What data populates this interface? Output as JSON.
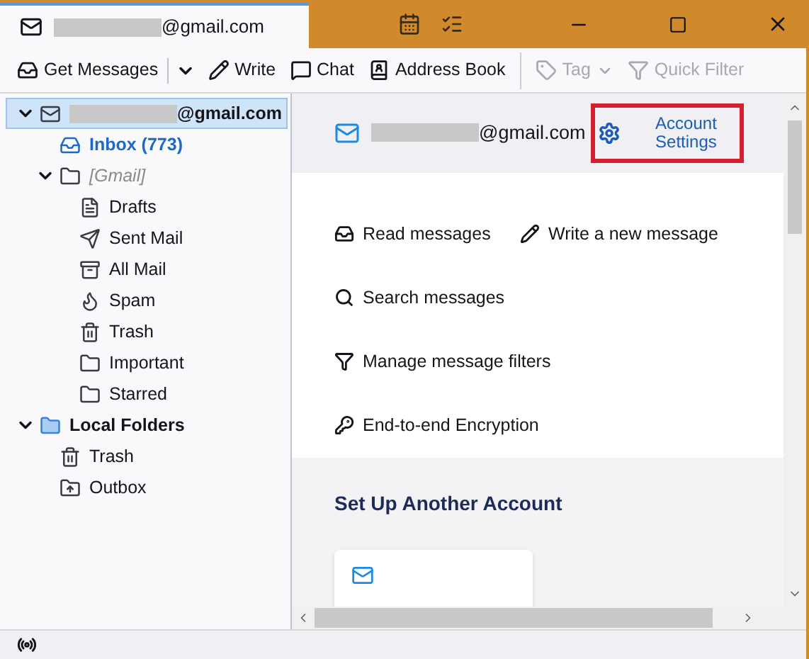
{
  "window": {
    "tab_title": "@gmail.com"
  },
  "toolbar": [
    {
      "label": "Get Messages",
      "kind": "split",
      "disabled": false
    },
    {
      "label": "Write",
      "kind": "write",
      "disabled": false
    },
    {
      "label": "Chat",
      "kind": "chat",
      "disabled": false
    },
    {
      "label": "Address Book",
      "kind": "book",
      "disabled": false
    },
    {
      "label": "Tag",
      "kind": "tag",
      "disabled": true
    },
    {
      "label": "Quick Filter",
      "kind": "filter",
      "disabled": true
    }
  ],
  "folders": [
    {
      "label": "@gmail.com",
      "kind": "account",
      "expanded": true,
      "selected": true,
      "children": [
        {
          "label": "Inbox (773)",
          "kind": "inbox",
          "unread": true,
          "selected": false
        },
        {
          "label": "[Gmail]",
          "kind": "group",
          "expanded": true,
          "selected": false,
          "children": [
            {
              "label": "Drafts",
              "kind": "drafts",
              "selected": false
            },
            {
              "label": "Sent Mail",
              "kind": "sent",
              "selected": false
            },
            {
              "label": "All Mail",
              "kind": "allmail",
              "selected": false
            },
            {
              "label": "Spam",
              "kind": "spam",
              "selected": false
            },
            {
              "label": "Trash",
              "kind": "trash",
              "selected": false
            },
            {
              "label": "Important",
              "kind": "folder",
              "selected": false
            },
            {
              "label": "Starred",
              "kind": "folder",
              "selected": false
            }
          ]
        }
      ]
    },
    {
      "label": "Local Folders",
      "kind": "local",
      "expanded": true,
      "selected": false,
      "children": [
        {
          "label": "Trash",
          "kind": "trash",
          "selected": false
        },
        {
          "label": "Outbox",
          "kind": "outbox",
          "selected": false
        }
      ]
    }
  ],
  "account_header": {
    "email": "@gmail.com",
    "settings_label": "Account Settings"
  },
  "actions": [
    {
      "label": "Read messages",
      "kind": "read"
    },
    {
      "label": "Write a new message",
      "kind": "write"
    },
    {
      "label": "Search messages",
      "kind": "search"
    },
    {
      "label": "Manage message filters",
      "kind": "filter"
    },
    {
      "label": "End-to-end Encryption",
      "kind": "key"
    }
  ],
  "setup": {
    "title": "Set Up Another Account"
  }
}
